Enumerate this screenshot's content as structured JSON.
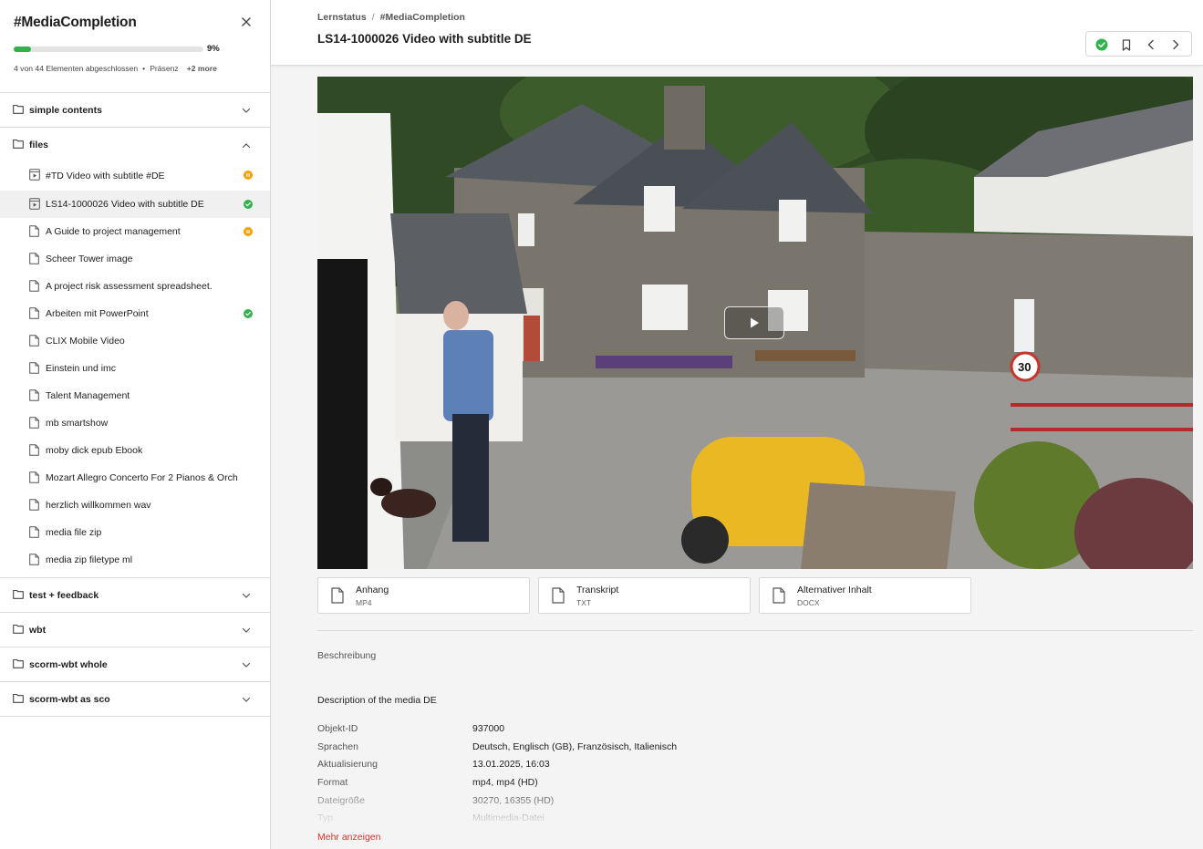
{
  "sidebar": {
    "title": "#MediaCompletion",
    "progress": {
      "percent": 9,
      "label": "9%"
    },
    "meta": {
      "completed": "4 von 44 Elementen abgeschlossen",
      "mode": "Präsenz",
      "more": "+2 more"
    },
    "sections": [
      {
        "label": "simple contents",
        "expanded": false,
        "items": []
      },
      {
        "label": "files",
        "expanded": true,
        "items": [
          {
            "label": "#TD Video with subtitle #DE",
            "icon": "video-file-icon",
            "status": "pending",
            "active": false
          },
          {
            "label": "LS14-1000026 Video with subtitle DE",
            "icon": "video-file-icon",
            "status": "done",
            "active": true
          },
          {
            "label": "A Guide to project management",
            "icon": "document-icon",
            "status": "pending",
            "active": false
          },
          {
            "label": "Scheer Tower image",
            "icon": "document-icon",
            "status": "",
            "active": false
          },
          {
            "label": "A project risk assessment spreadsheet.",
            "icon": "document-icon",
            "status": "",
            "active": false
          },
          {
            "label": "Arbeiten mit PowerPoint",
            "icon": "document-icon",
            "status": "done",
            "active": false
          },
          {
            "label": "CLIX Mobile Video",
            "icon": "document-icon",
            "status": "",
            "active": false
          },
          {
            "label": "Einstein und imc",
            "icon": "document-icon",
            "status": "",
            "active": false
          },
          {
            "label": "Talent Management",
            "icon": "document-icon",
            "status": "",
            "active": false
          },
          {
            "label": "mb smartshow",
            "icon": "document-icon",
            "status": "",
            "active": false
          },
          {
            "label": "moby dick epub Ebook",
            "icon": "document-icon",
            "status": "",
            "active": false
          },
          {
            "label": "Mozart Allegro Concerto For 2 Pianos & Orch",
            "icon": "document-icon",
            "status": "",
            "active": false
          },
          {
            "label": "herzlich willkommen wav",
            "icon": "document-icon",
            "status": "",
            "active": false
          },
          {
            "label": "media file zip",
            "icon": "document-icon",
            "status": "",
            "active": false
          },
          {
            "label": "media zip filetype ml",
            "icon": "document-icon",
            "status": "",
            "active": false
          }
        ]
      },
      {
        "label": "test + feedback",
        "expanded": false,
        "items": []
      },
      {
        "label": "wbt",
        "expanded": false,
        "items": []
      },
      {
        "label": "scorm-wbt whole",
        "expanded": false,
        "items": []
      },
      {
        "label": "scorm-wbt as sco",
        "expanded": false,
        "items": []
      }
    ]
  },
  "header": {
    "breadcrumb": [
      "Lernstatus",
      "#MediaCompletion"
    ],
    "title": "LS14-1000026 Video with subtitle DE",
    "toolbar": [
      "check-circle-icon",
      "bookmark-icon",
      "chevron-left-icon",
      "chevron-right-icon"
    ]
  },
  "attachments": [
    {
      "label": "Anhang",
      "type": "MP4"
    },
    {
      "label": "Transkript",
      "type": "TXT"
    },
    {
      "label": "Alternativer Inhalt",
      "type": "DOCX"
    }
  ],
  "description": {
    "label": "Beschreibung",
    "text": "Description of the media DE"
  },
  "metadata": [
    {
      "key": "Objekt-ID",
      "value": "937000"
    },
    {
      "key": "Sprachen",
      "value": "Deutsch, Englisch (GB), Französisch, Italienisch"
    },
    {
      "key": "Aktualisierung",
      "value": "13.01.2025, 16:03"
    },
    {
      "key": "Format",
      "value": "mp4, mp4 (HD)"
    },
    {
      "key": "Dateigröße",
      "value": "30270, 16355 (HD)"
    },
    {
      "key": "Typ",
      "value": "Multimedia-Datei"
    }
  ],
  "more_label": "Mehr anzeigen",
  "colors": {
    "accent": "#31b24c",
    "pending": "#f2a100",
    "link": "#d4332b"
  }
}
